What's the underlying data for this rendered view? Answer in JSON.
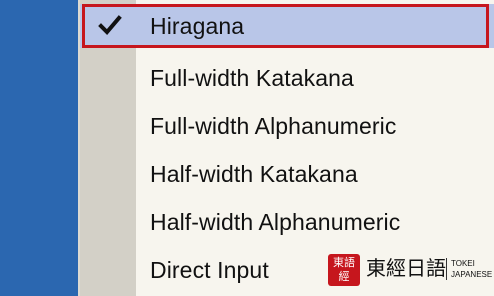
{
  "menu": {
    "items": [
      {
        "label": "Hiragana",
        "checked": true,
        "selected": true
      },
      {
        "label": "Full-width Katakana",
        "checked": false,
        "selected": false
      },
      {
        "label": "Full-width Alphanumeric",
        "checked": false,
        "selected": false
      },
      {
        "label": "Half-width Katakana",
        "checked": false,
        "selected": false
      },
      {
        "label": "Half-width Alphanumeric",
        "checked": false,
        "selected": false
      },
      {
        "label": "Direct Input",
        "checked": false,
        "selected": false
      }
    ],
    "check_icon": "checkmark-icon"
  },
  "watermark": {
    "seal_text": "東語經",
    "brand": "東經日語",
    "side_text": "TOKEI\nJAPANESE"
  },
  "colors": {
    "desktop_blue": "#2a62a8",
    "menu_bg": "#f7f5ee",
    "gutter": "#d3d0c7",
    "highlight": "#b9c6e8",
    "frame_red": "#c6161d"
  }
}
